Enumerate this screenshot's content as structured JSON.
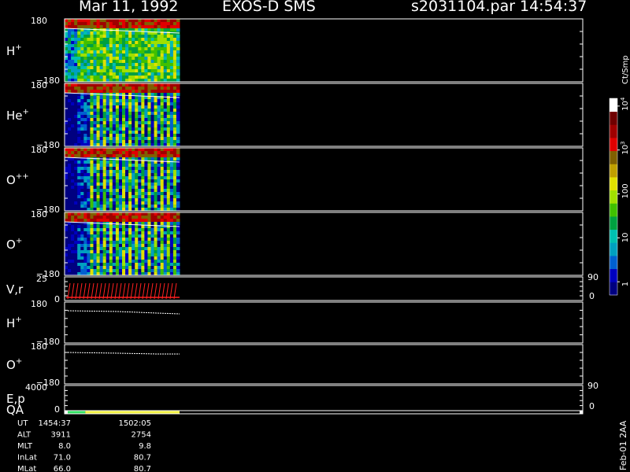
{
  "header": {
    "date": "Mar 11, 1992",
    "mission": "EXOS-D SMS",
    "file": "s2031104.par",
    "time": "14:54:37"
  },
  "side_label": "Feb-01 2AA",
  "colorbar": {
    "unit": "Ct/Smp",
    "ticks": [
      "1",
      "10",
      "100",
      "10",
      "10"
    ],
    "tick_exponents": [
      "",
      "",
      "",
      "3",
      "4"
    ],
    "tick_values": [
      1,
      10,
      100,
      1000,
      10000
    ],
    "range": [
      0.5,
      15000
    ],
    "colors": [
      "#000080",
      "#0000c0",
      "#0060d0",
      "#00a0c0",
      "#00c0b0",
      "#00a040",
      "#40c000",
      "#a0e000",
      "#e0e000",
      "#c0a000",
      "#806000",
      "#e00000",
      "#a00000",
      "#700000",
      "#ffffff"
    ]
  },
  "panels": [
    {
      "id": "h-plus",
      "label": "H",
      "sup": "+",
      "ymax": "180",
      "ymin": "−180",
      "r0": "",
      "r1": ""
    },
    {
      "id": "he-plus",
      "label": "He",
      "sup": "+",
      "ymax": "180",
      "ymin": "−180",
      "r0": "",
      "r1": ""
    },
    {
      "id": "o-plus-plus",
      "label": "O",
      "sup": "++",
      "ymax": "180",
      "ymin": "−180",
      "r0": "",
      "r1": ""
    },
    {
      "id": "o-plus",
      "label": "O",
      "sup": "+",
      "ymax": "180",
      "ymin": "−180",
      "r0": "",
      "r1": ""
    },
    {
      "id": "vr",
      "label": "V,r",
      "sup": "",
      "ymax": "25",
      "ymin": "0",
      "r0": "0",
      "r1": "90"
    },
    {
      "id": "h-plus-line",
      "label": "H",
      "sup": "+",
      "ymax": "180",
      "ymin": "−180",
      "r0": "",
      "r1": ""
    },
    {
      "id": "o-plus-line",
      "label": "O",
      "sup": "+",
      "ymax": "180",
      "ymin": "−180",
      "r0": "",
      "r1": ""
    },
    {
      "id": "ep",
      "label": "E,p",
      "sup": "",
      "ymax": "4000",
      "ymin": "0",
      "r0": "0",
      "r1": "90"
    },
    {
      "id": "qa",
      "label": "QA",
      "sup": "",
      "ymax": "",
      "ymin": "",
      "r0": "",
      "r1": ""
    }
  ],
  "footer": {
    "rows": [
      {
        "label": "UT",
        "v1": "1454:37",
        "v2": "1502:05"
      },
      {
        "label": "ALT",
        "v1": "3911",
        "v2": "2754"
      },
      {
        "label": "MLT",
        "v1": "8.0",
        "v2": "9.8"
      },
      {
        "label": "InLat",
        "v1": "71.0",
        "v2": "80.7"
      },
      {
        "label": "MLat",
        "v1": "66.0",
        "v2": "80.7"
      }
    ]
  },
  "chart_data": {
    "type": "heatmap",
    "title": "Mar 11, 1992   EXOS-D SMS",
    "time_range": [
      "1454:37",
      "1502:05"
    ],
    "ion_panels": [
      "H+",
      "He+",
      "O++",
      "O+"
    ],
    "ylim": [
      -180,
      180
    ],
    "quality_flags": [
      {
        "color": "#30e060",
        "start_fraction": 0.0,
        "end_fraction": 0.18
      },
      {
        "color": "#f0f040",
        "start_fraction": 0.18,
        "end_fraction": 1.0
      }
    ]
  }
}
